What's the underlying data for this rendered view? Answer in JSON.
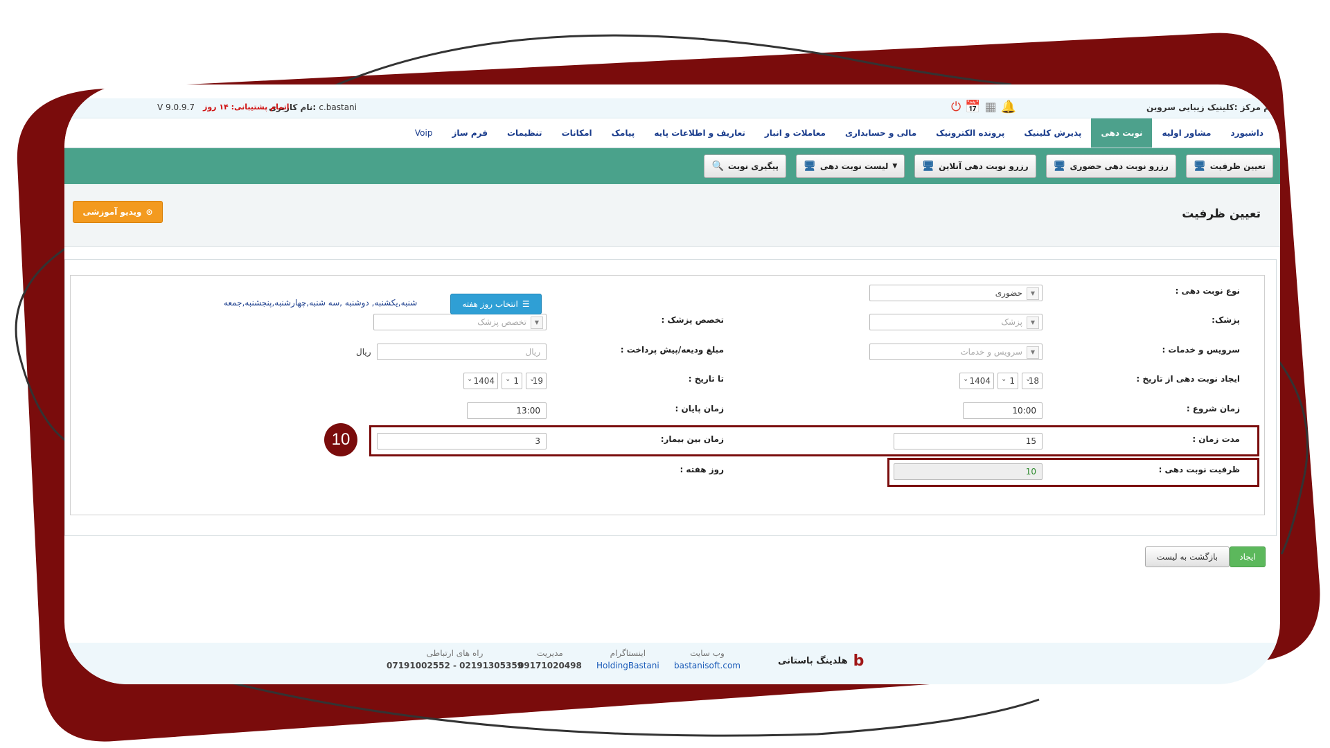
{
  "topbar": {
    "center_name": "نام مرکز :کلینیک زیبایی سروین",
    "user_label": "نام کاربری:",
    "user_value": "c.bastani",
    "support_label": "اتمام پشتیبانی:",
    "support_value": "۱۴ روز",
    "version": "V 9.0.9.7"
  },
  "main_nav": [
    "داشبورد",
    "مشاور اولیه",
    "نوبت دهی",
    "پذیرش کلینیک",
    "پرونده الکترونیک",
    "مالی و حسابداری",
    "معاملات و انبار",
    "تعاریف و اطلاعات پایه",
    "پیامک",
    "امکانات",
    "تنظیمات",
    "فرم ساز",
    "Voip"
  ],
  "sub_nav": [
    "تعیین ظرفیت",
    "رزرو نوبت دهی حضوری",
    "رزرو نوبت دهی آنلاین",
    "لیست نوبت دهی",
    "پیگیری نوبت"
  ],
  "page": {
    "title": "تعیین ظرفیت",
    "video_button": "ویدیو آموزشی"
  },
  "form": {
    "appointment_type_label": "نوع نوبت دهی :",
    "appointment_type_value": "حضوری",
    "doctor_label": "پزشک:",
    "doctor_placeholder": "پزشک",
    "specialty_label": "تخصص پزشک :",
    "specialty_placeholder": "تخصص پزشک",
    "service_label": "سرویس و خدمات :",
    "service_placeholder": "سرویس و خدمات",
    "deposit_label": "مبلغ ودیعه/پیش پرداخت :",
    "deposit_placeholder": "ریال",
    "deposit_unit": "ریال",
    "from_date_label": "ایجاد نوبت دهی از تاریخ :",
    "from_date": {
      "day": "18",
      "month": "1",
      "year": "1404"
    },
    "to_date_label": "تا تاریخ :",
    "to_date": {
      "day": "19",
      "month": "1",
      "year": "1404"
    },
    "start_time_label": "زمان شروع :",
    "start_time": "10:00",
    "end_time_label": "زمان پایان :",
    "end_time": "13:00",
    "duration_label": "مدت زمان :",
    "duration": "15",
    "between_label": "زمان بین بیمار:",
    "between": "3",
    "capacity_label": "ظرفیت نوبت دهی :",
    "capacity": "10",
    "weekday_label": "روز هفته :",
    "weekday_button": "انتخاب روز هفته",
    "weekday_text": "شنبه,یکشنبه, دوشنبه ,سه شنبه,چهارشنبه,پنجشنبه,جمعه"
  },
  "badge": "10",
  "actions": {
    "create": "ایجاد",
    "back": "بازگشت به لیست"
  },
  "footer": {
    "brand": "هلدینگ باستانی",
    "website_label": "وب سایت",
    "website_value": "bastanisoft.com",
    "instagram_label": "اینستاگرام",
    "instagram_value": "HoldingBastani",
    "management_label": "مدیریت",
    "management_value": "09171020498",
    "contact_label": "راه های ارتباطی",
    "contact_value": "07191002552 - 02191305359"
  },
  "colors": {
    "accent": "#4aa28b",
    "frame": "#7a0c0c",
    "link": "#1a3c8c"
  }
}
